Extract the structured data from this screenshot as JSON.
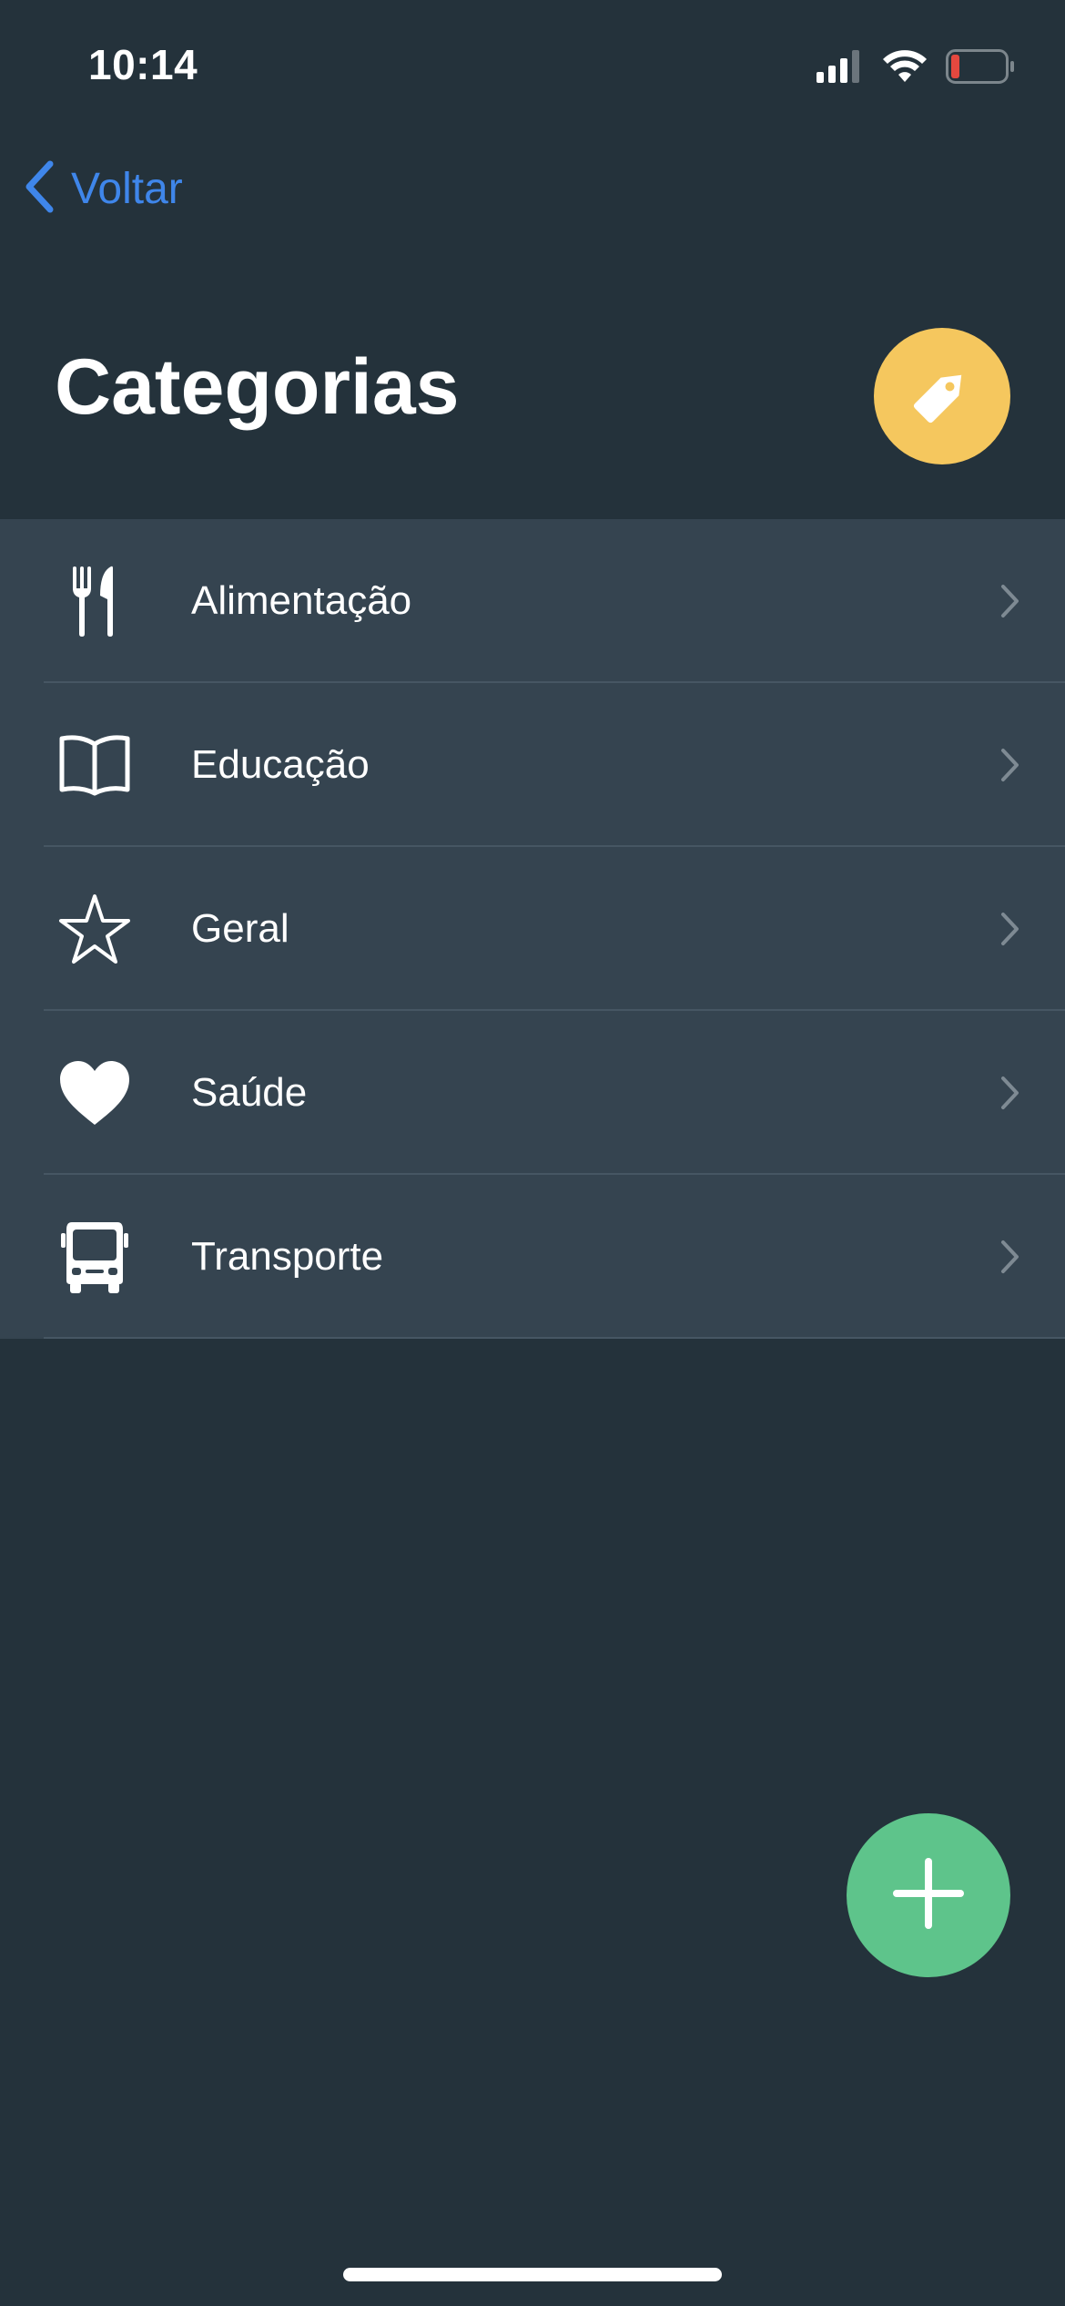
{
  "status_bar": {
    "time": "10:14",
    "signal_icon": "cellular-signal-icon",
    "wifi_icon": "wifi-icon",
    "battery_icon": "battery-low-icon",
    "battery_level_color": "#E5483F"
  },
  "nav": {
    "back_label": "Voltar",
    "back_color": "#3F86EA"
  },
  "header": {
    "title": "Categorias",
    "tag_button_icon": "tag-icon",
    "tag_button_color": "#F5C75E"
  },
  "categories": [
    {
      "label": "Alimentação",
      "icon": "fork-knife-icon"
    },
    {
      "label": "Educação",
      "icon": "book-icon"
    },
    {
      "label": "Geral",
      "icon": "star-icon"
    },
    {
      "label": "Saúde",
      "icon": "heart-icon"
    },
    {
      "label": "Transporte",
      "icon": "bus-icon"
    }
  ],
  "fab": {
    "icon": "plus-icon",
    "color": "#5EC48B"
  },
  "colors": {
    "background": "#24323B",
    "list_background": "#354450"
  }
}
